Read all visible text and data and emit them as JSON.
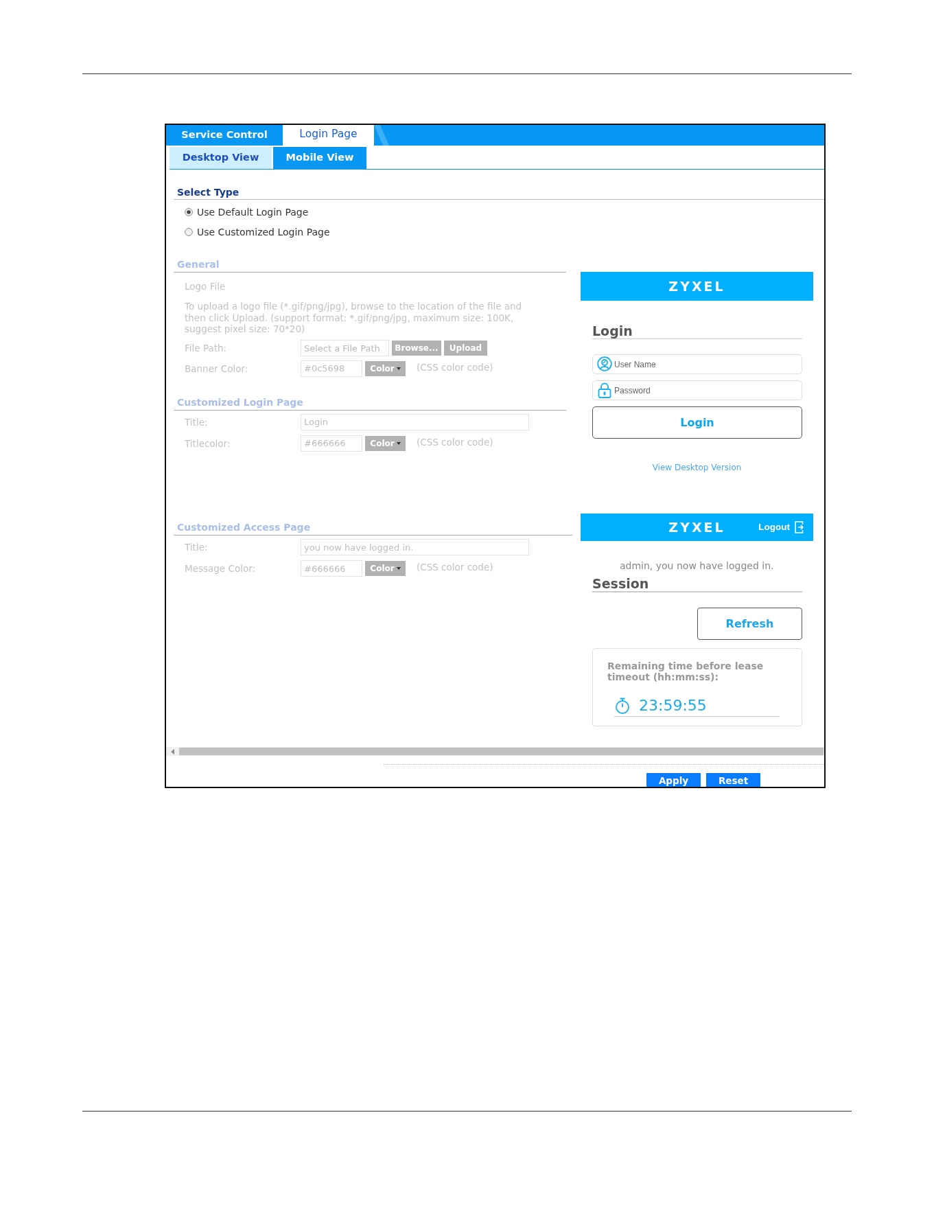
{
  "top_tabs": [
    {
      "label": "Service Control",
      "selected": false
    },
    {
      "label": "Login Page",
      "selected": true
    }
  ],
  "sub_tabs": [
    {
      "label": "Desktop View",
      "selected": false
    },
    {
      "label": "Mobile View",
      "selected": true
    }
  ],
  "select_type": {
    "heading": "Select Type",
    "options": [
      {
        "label": "Use Default Login Page",
        "selected": true
      },
      {
        "label": "Use Customized Login Page",
        "selected": false
      }
    ]
  },
  "login_page": {
    "sections": [
      {
        "heading": "General",
        "disabled": true,
        "rows": [
          {
            "kind": "caption",
            "label": "Logo File"
          },
          {
            "kind": "note",
            "text": "To upload a logo file (*.gif/png/jpg), browse to the location of the file and then click Upload. (support format: *.gif/png/jpg, maximum size: 100K, suggest pixel size: 70*20)"
          },
          {
            "kind": "file",
            "label": "File Path:",
            "placeholder": "Select a File Path",
            "buttons": [
              "Browse...",
              "Upload"
            ]
          },
          {
            "kind": "color",
            "label": "Banner Color:",
            "value": "#0c5698",
            "button": "Color",
            "hint": "(CSS color code)"
          }
        ]
      },
      {
        "heading": "Customized Login Page",
        "disabled": true,
        "rows": [
          {
            "kind": "text",
            "label": "Title:",
            "value": "Login"
          },
          {
            "kind": "color",
            "label": "Titlecolor:",
            "value": "#666666",
            "button": "Color",
            "hint": "(CSS color code)"
          }
        ]
      }
    ],
    "preview": {
      "logo": "ZYXEL",
      "title": "Login",
      "fields": [
        {
          "kind": "username",
          "placeholder": "User Name"
        },
        {
          "kind": "password",
          "placeholder": "Password"
        }
      ],
      "button": "Login",
      "link": "View Desktop Version"
    }
  },
  "access_page": {
    "sections": [
      {
        "heading": "Customized Access Page",
        "disabled": true,
        "rows": [
          {
            "kind": "text",
            "label": "Title:",
            "value": "you now have logged in."
          },
          {
            "kind": "color",
            "label": "Message Color:",
            "value": "#666666",
            "button": "Color",
            "hint": "(CSS color code)"
          }
        ]
      }
    ],
    "preview": {
      "logo": "ZYXEL",
      "logout": "Logout",
      "message": "admin, you now have logged in.",
      "title": "Session",
      "button": "Refresh",
      "timer_label": "Remaining time before lease timeout (hh:mm:ss):",
      "timer": "23:59:55"
    }
  },
  "footer": {
    "buttons": [
      "Apply",
      "Reset"
    ]
  }
}
